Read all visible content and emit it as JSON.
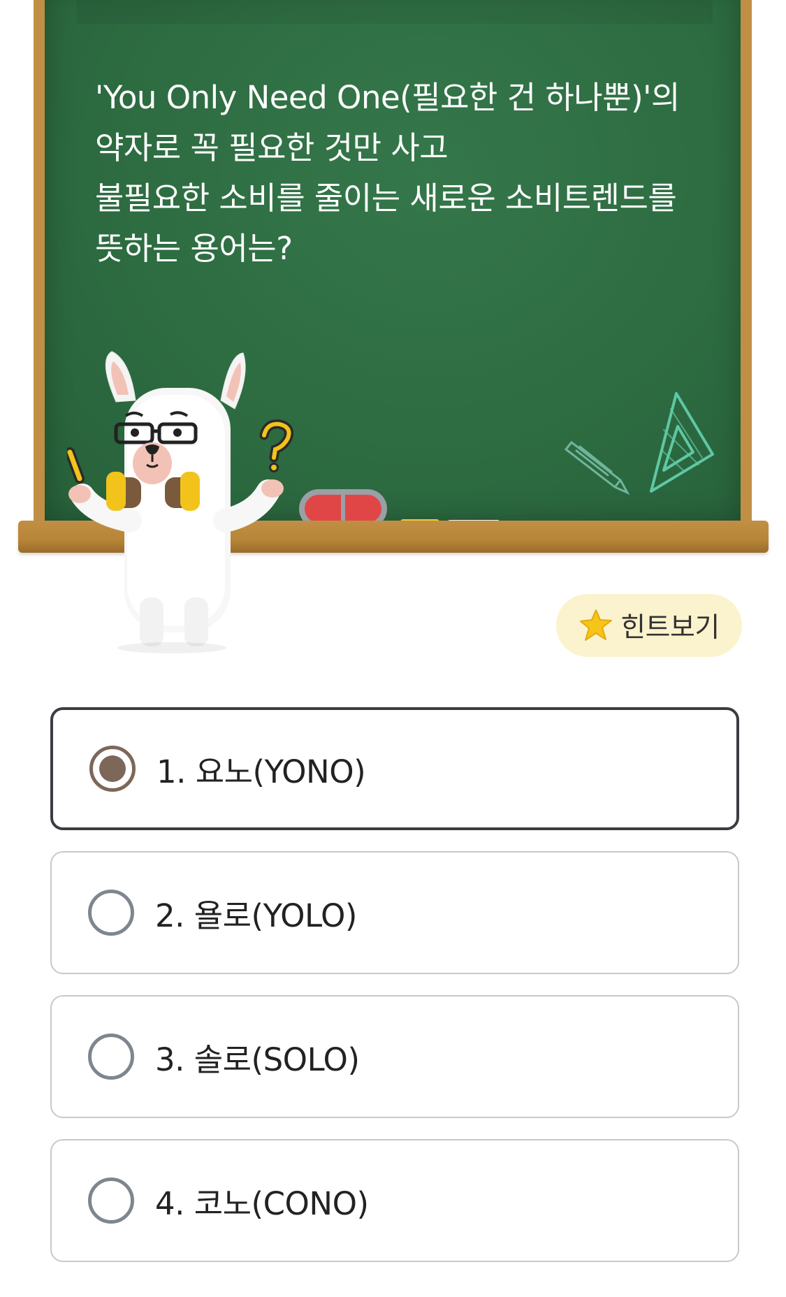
{
  "question": {
    "lines": [
      "'You Only Need One(필요한 건 하나뿐)'의",
      "약자로 꼭 필요한 것만 사고",
      "불필요한 소비를 줄이는 새로운 소비트렌드를",
      "뜻하는 용어는?"
    ]
  },
  "hint": {
    "label": "힌트보기",
    "icon": "star-icon"
  },
  "options": [
    {
      "text": "1. 요노(YONO)",
      "selected": true
    },
    {
      "text": "2. 욜로(YOLO)",
      "selected": false
    },
    {
      "text": "3. 솔로(SOLO)",
      "selected": false
    },
    {
      "text": "4. 코노(CONO)",
      "selected": false
    }
  ],
  "colors": {
    "chalkboard": "#2f6e43",
    "frame": "#c08f45",
    "hint_bg": "#fbf3cd",
    "selected_radio": "#7d6758"
  }
}
